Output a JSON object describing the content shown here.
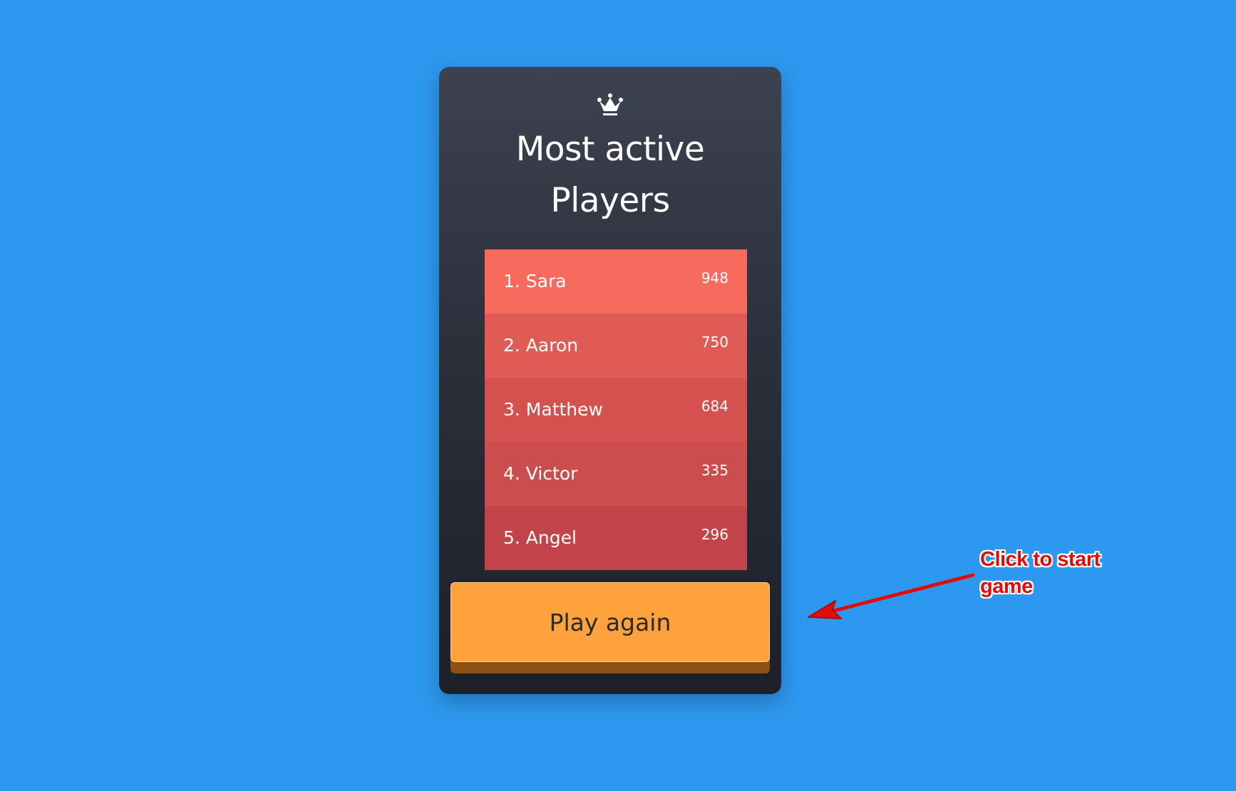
{
  "leaderboard": {
    "title_line1": "Most active",
    "title_line2": "Players",
    "icon": "crown-icon",
    "players": [
      {
        "name": "1. Sara",
        "score": "948",
        "color": "#f76a5e"
      },
      {
        "name": "2. Aaron",
        "score": "750",
        "color": "#e05b55"
      },
      {
        "name": "3. Matthew",
        "score": "684",
        "color": "#d55150"
      },
      {
        "name": "4. Victor",
        "score": "335",
        "color": "#cb4d4e"
      },
      {
        "name": "5. Angel",
        "score": "296",
        "color": "#c3434a"
      }
    ]
  },
  "play_button": {
    "label": "Play again",
    "color": "#fea23d"
  },
  "annotation": {
    "line1": "Click to start",
    "line2": "game",
    "color": "#e10d0d"
  },
  "colors": {
    "background": "#2d98ef",
    "card_top": "#3d4250",
    "card_bottom": "#1d2029"
  }
}
